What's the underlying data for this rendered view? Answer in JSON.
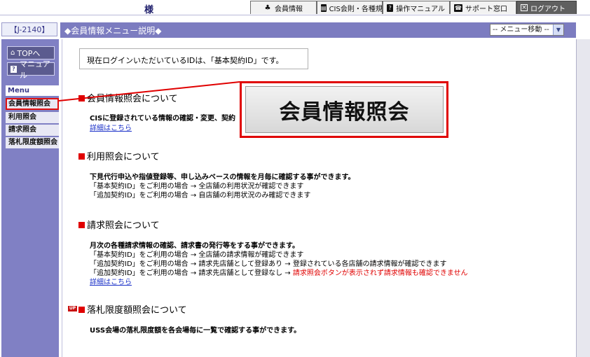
{
  "topbar": {
    "greeting": "様",
    "tabs": [
      {
        "label": "会員情報",
        "icon": "club-icon"
      },
      {
        "label": "CIS会則・各種規約",
        "icon": "document-icon"
      },
      {
        "label": "操作マニュアル",
        "icon": "help-icon"
      },
      {
        "label": "サポート窓口",
        "icon": "phone-icon"
      },
      {
        "label": "ログアウト",
        "icon": "close-box-icon"
      }
    ]
  },
  "header": {
    "id_code": "【J-2140】",
    "title": "◆会員情報メニュー説明◆",
    "menu_select": "-- メニュー移動 --"
  },
  "sidebar": {
    "top_button": "TOPへ",
    "manual_button": "マニュアル",
    "menu_heading": "Menu",
    "items": [
      {
        "label": "会員情報照会",
        "active": true
      },
      {
        "label": "利用照会",
        "active": false
      },
      {
        "label": "請求照会",
        "active": false
      },
      {
        "label": "落札限度額照会",
        "active": false
      }
    ]
  },
  "main": {
    "notice": "現在ログインいただいているIDは、「基本契約ID」です。",
    "callout_label": "会員情報照会",
    "sections": [
      {
        "title": "会員情報照会について",
        "lines": [
          "CISに登録されている情報の確認・変更、契約"
        ],
        "link": "詳細はこちら"
      },
      {
        "title": "利用照会について",
        "lines": [
          "下見代行申込や指値登録等、申し込みベースの情報を月毎に確認する事ができます。",
          "「基本契約ID」をご利用の場合 → 全店舗の利用状況が確認できます",
          "「追加契約ID」をご利用の場合 → 自店舗の利用状況のみ確認できます"
        ]
      },
      {
        "title": "請求照会について",
        "lines": [
          "月次の各種請求情報の確認、請求書の発行等をする事ができます。",
          "「基本契約ID」をご利用の場合 → 全店舗の請求情報が確認できます",
          "「追加契約ID」をご利用の場合 → 請求先店舗として登録あり → 登録されている各店舗の請求情報が確認できます"
        ],
        "line4_prefix": "「追加契約ID」をご利用の場合 → 請求先店舗として登録なし → ",
        "line4_red": "請求照会ボタンが表示されず請求情報も確認できません",
        "link": "詳細はこちら"
      },
      {
        "title": "落札限度額照会について",
        "badge": "UP",
        "lines": [
          "USS会場の落札限度額を各会場毎に一覧で確認する事ができます。"
        ]
      }
    ]
  },
  "colors": {
    "accent": "#7c7cc0",
    "sidebar": "#8080c4",
    "highlight": "#e00000",
    "link": "#1a30c8"
  }
}
